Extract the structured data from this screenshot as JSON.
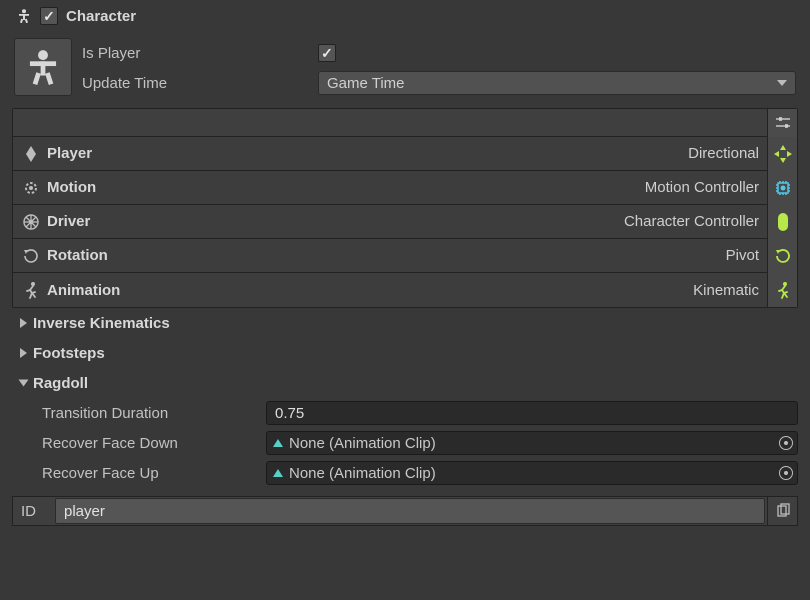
{
  "header": {
    "title": "Character"
  },
  "props": {
    "is_player_label": "Is Player",
    "is_player_value": true,
    "update_time_label": "Update Time",
    "update_time_value": "Game Time"
  },
  "rows": [
    {
      "icon": "diamond",
      "label": "Player",
      "value": "Directional",
      "end_icon": "dpad",
      "accent": true
    },
    {
      "icon": "gear",
      "label": "Motion",
      "value": "Motion Controller",
      "end_icon": "chip",
      "accent": false
    },
    {
      "icon": "wheel",
      "label": "Driver",
      "value": "Character Controller",
      "end_icon": "capsule",
      "accent": true
    },
    {
      "icon": "rotate",
      "label": "Rotation",
      "value": "Pivot",
      "end_icon": "rotate",
      "accent": true
    },
    {
      "icon": "run",
      "label": "Animation",
      "value": "Kinematic",
      "end_icon": "run",
      "accent": true
    }
  ],
  "foldouts": {
    "ik": {
      "label": "Inverse Kinematics",
      "open": false
    },
    "footsteps": {
      "label": "Footsteps",
      "open": false
    },
    "ragdoll": {
      "label": "Ragdoll",
      "open": true,
      "transition_label": "Transition Duration",
      "transition_value": "0.75",
      "recover_down_label": "Recover Face Down",
      "recover_down_value": "None (Animation Clip)",
      "recover_up_label": "Recover Face Up",
      "recover_up_value": "None (Animation Clip)"
    }
  },
  "id": {
    "label": "ID",
    "value": "player"
  }
}
